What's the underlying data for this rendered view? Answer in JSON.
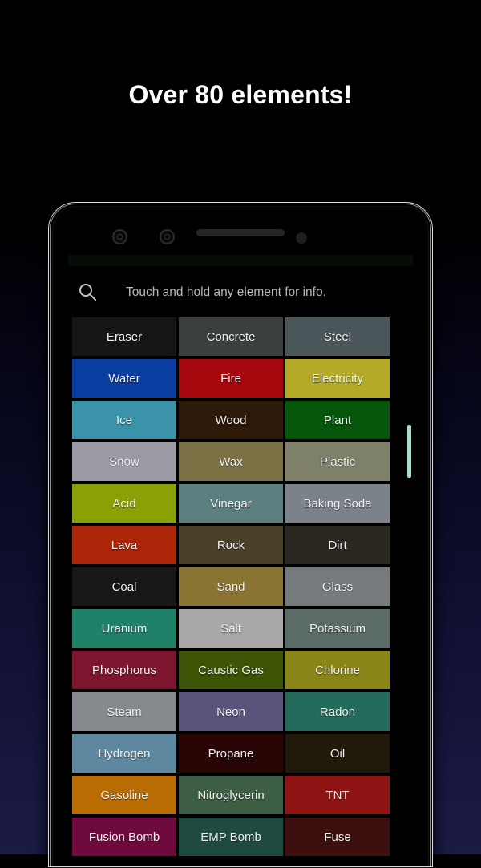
{
  "headline": "Over 80 elements!",
  "phone": {
    "hardware": {
      "camera_1": "camera-lens",
      "camera_2": "camera-lens",
      "speaker": "earpiece-speaker",
      "sensor": "proximity-sensor"
    }
  },
  "app": {
    "search": {
      "icon": "search-icon",
      "placeholder": "Touch and hold any element for info.",
      "value": ""
    },
    "scrollbar": {
      "thumb_color": "#a9ddc9"
    },
    "grid": {
      "columns": 3,
      "rows": [
        [
          {
            "label": "Eraser",
            "color": "#151515"
          },
          {
            "label": "Concrete",
            "color": "#39403f"
          },
          {
            "label": "Steel",
            "color": "#4a5659"
          }
        ],
        [
          {
            "label": "Water",
            "color": "#0a3da0"
          },
          {
            "label": "Fire",
            "color": "#a6070d"
          },
          {
            "label": "Electricity",
            "color": "#b3ab27"
          }
        ],
        [
          {
            "label": "Ice",
            "color": "#3a93a8"
          },
          {
            "label": "Wood",
            "color": "#2d1a09"
          },
          {
            "label": "Plant",
            "color": "#05550a"
          }
        ],
        [
          {
            "label": "Snow",
            "color": "#9a9aa4"
          },
          {
            "label": "Wax",
            "color": "#7a7044"
          },
          {
            "label": "Plastic",
            "color": "#7f8069"
          }
        ],
        [
          {
            "label": "Acid",
            "color": "#8aa005"
          },
          {
            "label": "Vinegar",
            "color": "#5c8080"
          },
          {
            "label": "Baking Soda",
            "color": "#7b828a"
          }
        ],
        [
          {
            "label": "Lava",
            "color": "#ab2508"
          },
          {
            "label": "Rock",
            "color": "#4a4129"
          },
          {
            "label": "Dirt",
            "color": "#2b2620"
          }
        ],
        [
          {
            "label": "Coal",
            "color": "#171717"
          },
          {
            "label": "Sand",
            "color": "#8a7434"
          },
          {
            "label": "Glass",
            "color": "#757a7d"
          }
        ],
        [
          {
            "label": "Uranium",
            "color": "#1e8168"
          },
          {
            "label": "Salt",
            "color": "#a8a8a8"
          },
          {
            "label": "Potassium",
            "color": "#5b6b66"
          }
        ],
        [
          {
            "label": "Phosphorus",
            "color": "#7d1730"
          },
          {
            "label": "Caustic Gas",
            "color": "#3d5406"
          },
          {
            "label": "Chlorine",
            "color": "#8a8517"
          }
        ],
        [
          {
            "label": "Steam",
            "color": "#868a8e"
          },
          {
            "label": "Neon",
            "color": "#5b537a"
          },
          {
            "label": "Radon",
            "color": "#256b5b"
          }
        ],
        [
          {
            "label": "Hydrogen",
            "color": "#5e87a0"
          },
          {
            "label": "Propane",
            "color": "#2a0505"
          },
          {
            "label": "Oil",
            "color": "#20190a"
          }
        ],
        [
          {
            "label": "Gasoline",
            "color": "#b96c02"
          },
          {
            "label": "Nitroglycerin",
            "color": "#3b5e44"
          },
          {
            "label": "TNT",
            "color": "#8e1414"
          }
        ],
        [
          {
            "label": "Fusion Bomb",
            "color": "#6e0a3d"
          },
          {
            "label": "EMP Bomb",
            "color": "#1e4a40"
          },
          {
            "label": "Fuse",
            "color": "#3d1010"
          }
        ]
      ]
    }
  }
}
